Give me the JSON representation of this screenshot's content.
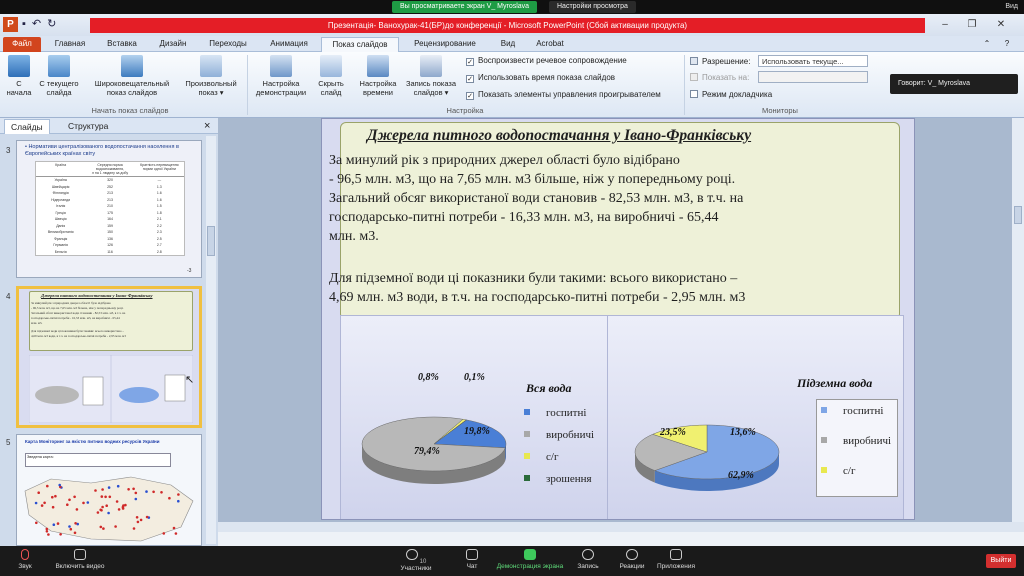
{
  "zoom_top": {
    "share_banner": "Вы просматриваете экран V_ Myroslava",
    "view_settings": "Настройки просмотра",
    "view_label": "Вид"
  },
  "window": {
    "title": "Презентація- Ванохурак-41(БР)до конференції  -  Microsoft PowerPoint (Сбой активации продукта)",
    "app_badge": "P"
  },
  "ribbon_tabs": [
    "Файл",
    "Главная",
    "Вставка",
    "Дизайн",
    "Переходы",
    "Анимация",
    "Показ слайдов",
    "Рецензирование",
    "Вид",
    "Acrobat"
  ],
  "ribbon": {
    "buttons": {
      "from_start": "С\nначала",
      "from_current": "С текущего\nслайда",
      "broadcast": "Широковещательный\nпоказ слайдов",
      "custom_show": "Произвольный\nпоказ ▾",
      "setup": "Настройка\nдемонстрации",
      "hide_slide": "Скрыть\nслайд",
      "timings": "Настройка\nвремени",
      "record": "Запись показа\nслайдов ▾"
    },
    "groups": {
      "start": "Начать показ слайдов",
      "setup": "Настройка",
      "monitors": "Мониторы"
    },
    "checks": {
      "narration": "Воспроизвести речевое сопровождение",
      "use_timings": "Использовать время показа слайдов",
      "show_controls": "Показать элементы управления проигрывателем"
    },
    "monitors": {
      "resolution_label": "Разрешение:",
      "resolution_value": "Использовать текуще...",
      "show_on_label": "Показать на:",
      "presenter_view": "Режим докладчика"
    }
  },
  "speaker": "Говорит: V_ Myroslava",
  "panel": {
    "tabs": [
      "Слайды",
      "Структура"
    ],
    "close": "×",
    "slide_numbers": [
      "3",
      "4",
      "5"
    ],
    "thumb3": {
      "title": "• Нормативи централізованого водопостачання населення в Європейських країнах світу",
      "col_headers": [
        "Країна",
        "Середня норма водоспоживання,\nл на 1 людину за добу",
        "Кратність перевищення\nнорми одної України"
      ],
      "rows": [
        [
          "Україна",
          "320",
          "—"
        ],
        [
          "Швейцарія",
          "252",
          "1.3"
        ],
        [
          "Фінляндія",
          "213",
          "1.6"
        ],
        [
          "Нідерланди",
          "213",
          "1.6"
        ],
        [
          "Італія",
          "210",
          "1.5"
        ],
        [
          "Греція",
          "175",
          "1.8"
        ],
        [
          "Швеція",
          "164",
          "2.1"
        ],
        [
          "Данія",
          "159",
          "2.2"
        ],
        [
          "Великобританія",
          "150",
          "2.3"
        ],
        [
          "Франція",
          "136",
          "2.5"
        ],
        [
          "Германія",
          "126",
          "2.7"
        ],
        [
          "Бельгія",
          "116",
          "2.8"
        ]
      ],
      "page": "-3"
    },
    "thumb4": {
      "title": "Джерела питного водопостачання у Івано-Франківську"
    },
    "thumb5": {
      "title": "Карта Моніторинг за якістю питних водних ресурсів України",
      "subtitle": "Зведена карта:"
    }
  },
  "slide": {
    "title": "Джерела питного водопостачання у Івано-Франківську",
    "lines": [
      "За минулий  рік з природних  джерел області було відібрано",
      " - 96,5 млн. м3, що на 7,65 млн. м3 більше, ніж у попередньому  році.",
      "Загальний обсяг використаної води становив - 82,53 млн. м3, в т.ч. на",
      "господарсько-питні  потреби - 16,33  млн. м3, на виробничі  - 65,44",
      "млн. м3.",
      "Для підземної води ці показники були такими: всього використано –",
      "4,69 млн. м3 води, в т.ч. на господарсько-питні  потреби - 2,95 млн. м3"
    ]
  },
  "chart_data": [
    {
      "type": "pie",
      "title": "Вся вода",
      "categories": [
        "госпитні",
        "виробничі",
        "с/г",
        "зрошення"
      ],
      "values": [
        19.8,
        79.4,
        0.8,
        0.1
      ],
      "labels": [
        "19,8%",
        "79,4%",
        "0,8%",
        "0,1%"
      ],
      "colors": {
        "госпитні": "#4a7fd6",
        "виробничі": "#b8b8b8",
        "с/г": "#f0f070",
        "зрошення": "#2a6a3a"
      },
      "legend": "right"
    },
    {
      "type": "pie",
      "title": "Підземна вода",
      "categories": [
        "госпитні",
        "виробничі",
        "с/г"
      ],
      "values": [
        62.9,
        23.5,
        13.6
      ],
      "labels": [
        "62,9%",
        "23,5%",
        "13,6%"
      ],
      "colors": {
        "госпитні": "#7fa6e6",
        "виробничі": "#b8b8b8",
        "с/г": "#f0f070"
      },
      "legend": "right"
    }
  ],
  "zoom_bottom": {
    "mute": "Звук",
    "video": "Включить видео",
    "participants": "Участники",
    "participants_count": "10",
    "chat": "Чат",
    "share": "Демонстрация экрана",
    "record": "Запись",
    "reactions": "Реакции",
    "apps": "Приложения",
    "leave": "Выйти"
  }
}
